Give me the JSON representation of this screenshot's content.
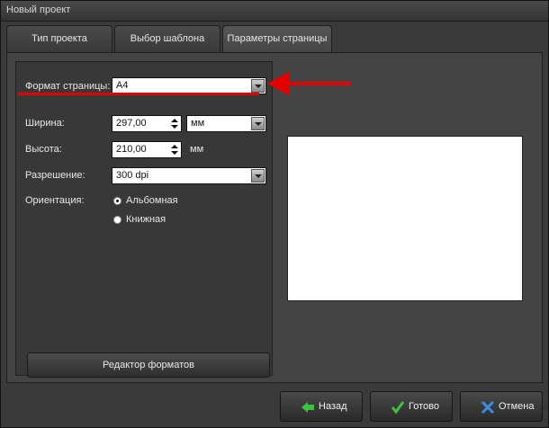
{
  "window": {
    "title": "Новый проект"
  },
  "tabs": [
    {
      "label": "Тип проекта"
    },
    {
      "label": "Выбор шаблона"
    },
    {
      "label": "Параметры страницы"
    }
  ],
  "form": {
    "page_format": {
      "label": "Формат страницы:",
      "value": "A4"
    },
    "width": {
      "label": "Ширина:",
      "value": "297,00",
      "unit": "мм"
    },
    "height": {
      "label": "Высота:",
      "value": "210,00",
      "unit": "мм"
    },
    "resolution": {
      "label": "Разрешение:",
      "value": "300 dpi"
    },
    "orientation": {
      "label": "Ориентация:",
      "options": [
        {
          "label": "Альбомная",
          "selected": true
        },
        {
          "label": "Книжная",
          "selected": false
        }
      ]
    }
  },
  "buttons": {
    "format_editor": "Редактор форматов",
    "back": "Назад",
    "done": "Готово",
    "cancel": "Отмена"
  },
  "colors": {
    "annotation_red": "#e30000",
    "back_icon": "#3cc43c",
    "done_icon": "#3cc43c",
    "cancel_icon": "#3a8ee6"
  }
}
